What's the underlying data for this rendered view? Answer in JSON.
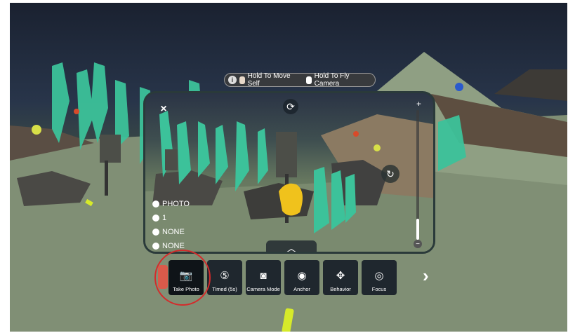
{
  "hint": {
    "info_icon": "info-icon",
    "move_label": "Hold To Move Self",
    "fly_label": "Hold To Fly Camera"
  },
  "viewfinder": {
    "close_icon": "×",
    "flip_icon": "⟳",
    "zoom_plus": "+",
    "zoom_minus": "−",
    "reset_icon": "↻",
    "expand_icon": "︿",
    "status": [
      {
        "icon": "camera-icon",
        "label": "PHOTO"
      },
      {
        "icon": "pin-icon",
        "label": "1"
      },
      {
        "icon": "aperture-icon",
        "label": "NONE"
      },
      {
        "icon": "toggle-icon",
        "label": "NONE"
      }
    ]
  },
  "toolbar": {
    "items": [
      {
        "label": "Take Photo",
        "icon": "camera-icon"
      },
      {
        "label": "Timed (5s)",
        "icon": "timer-icon"
      },
      {
        "label": "Camera Mode",
        "icon": "camera-mode-icon"
      },
      {
        "label": "Anchor",
        "icon": "anchor-icon"
      },
      {
        "label": "Behavior",
        "icon": "move-icon"
      },
      {
        "label": "Focus",
        "icon": "focus-icon"
      }
    ],
    "next_icon": "›"
  }
}
